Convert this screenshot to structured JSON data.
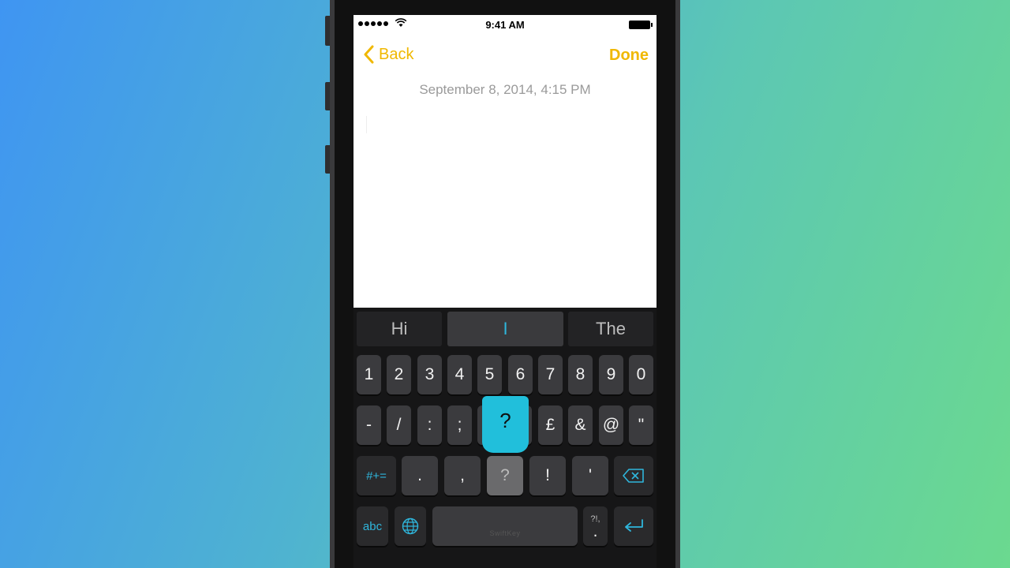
{
  "status_bar": {
    "time": "9:41 AM"
  },
  "nav": {
    "back_label": "Back",
    "done_label": "Done"
  },
  "note": {
    "date": "September 8, 2014, 4:15 PM"
  },
  "predictions": [
    "Hi",
    "I",
    "The"
  ],
  "keyboard": {
    "row1": [
      "1",
      "2",
      "3",
      "4",
      "5",
      "6",
      "7",
      "8",
      "9",
      "0"
    ],
    "row2": [
      "-",
      "/",
      ":",
      ";",
      "?",
      "£",
      "&",
      "@",
      "\""
    ],
    "row3": {
      "symbols_key": "#+=",
      "keys": [
        ".",
        ",",
        "?",
        "!",
        "'"
      ]
    },
    "row4": {
      "abc_key": "abc",
      "space_brand": "SwiftKey",
      "punct_top": "?!,",
      "punct_bottom": "."
    },
    "popup_key": "?"
  },
  "colors": {
    "accent": "#f0b800",
    "keyboard_accent": "#2fb6dc",
    "popup": "#21bfdb"
  },
  "icons": [
    "signal-dots-icon",
    "wifi-icon",
    "battery-icon",
    "chevron-left-icon",
    "globe-icon",
    "backspace-icon",
    "return-icon"
  ]
}
